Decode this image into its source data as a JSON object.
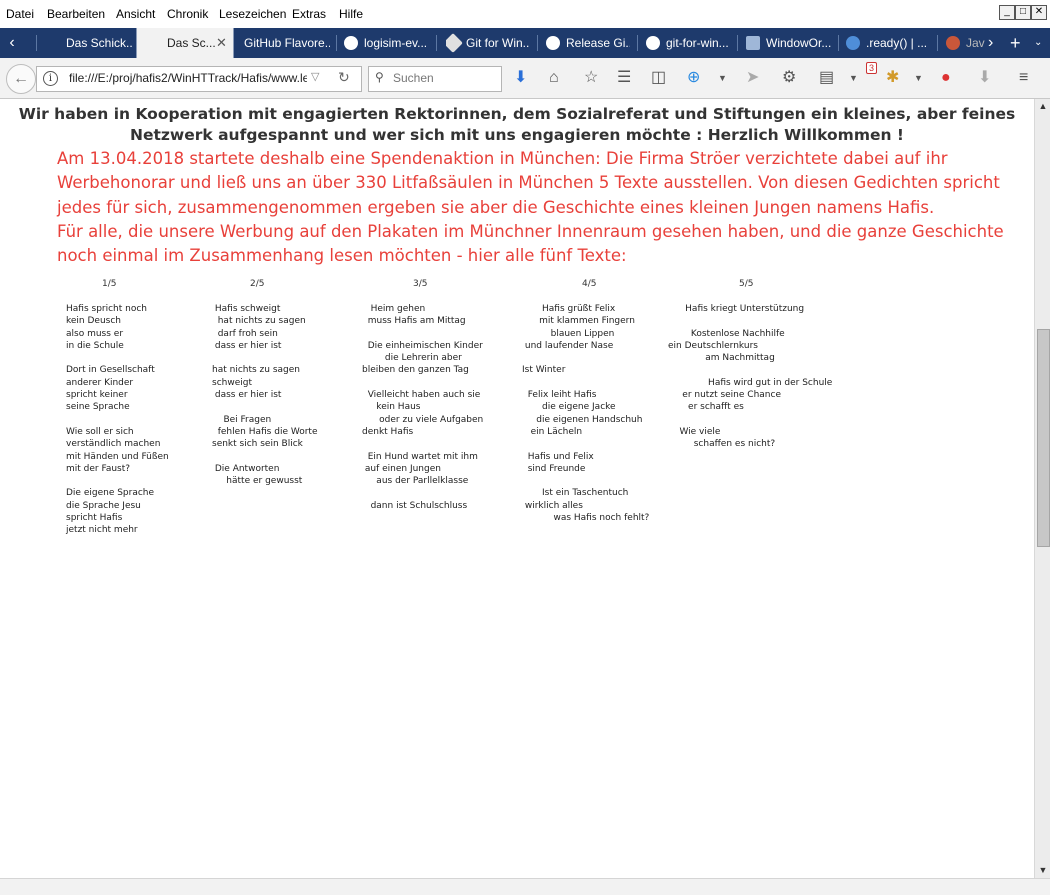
{
  "menu": [
    "Datei",
    "Bearbeiten",
    "Ansicht",
    "Chronik",
    "Lesezeichen",
    "Extras",
    "Hilfe"
  ],
  "tabs": [
    {
      "label": "Das Schick...",
      "active": false
    },
    {
      "label": "Das Sc...",
      "active": true
    },
    {
      "label": "GitHub Flavore...",
      "active": false
    },
    {
      "label": "logisim-ev...",
      "active": false
    },
    {
      "label": "Git for Win...",
      "active": false
    },
    {
      "label": "Release Gi...",
      "active": false
    },
    {
      "label": "git-for-win...",
      "active": false
    },
    {
      "label": "WindowOr...",
      "active": false
    },
    {
      "label": ".ready() | ...",
      "active": false
    },
    {
      "label": "Jav",
      "active": false
    }
  ],
  "nav": {
    "url": "file:///E:/proj/hafis2/WinHTTrack/Hafis/www.lern",
    "search_placeholder": "Suchen",
    "badge_count": "3"
  },
  "content": {
    "intro_line1": "Wir haben in Kooperation mit engagierten Rektorinnen, dem Sozialreferat und Stiftungen ein kleines, aber feines",
    "intro_line2": "Netzwerk aufgespannt und wer sich mit uns engagieren möchte : Herzlich Willkommen !",
    "red_lines": [
      "Am 13.04.2018 startete deshalb eine Spendenaktion in München: Die Firma Ströer verzichtete dabei auf ihr",
      "Werbehonorar und ließ uns an über 330 Litfaßsäulen in München 5 Texte ausstellen. Von diesen Gedichten spricht",
      "jedes für sich, zusammengenommen ergeben sie aber die Geschichte eines kleinen Jungen namens Hafis.",
      "Für alle, die unsere Werbung auf den Plakaten im Münchner Innenraum gesehen haben, und die ganze Geschichte",
      "noch einmal im Zusammenhang lesen möchten - hier alle fünf Texte:"
    ],
    "poems": [
      {
        "number": "1/5",
        "text": "Hafis spricht noch\nkein Deusch\nalso muss er\nin die Schule\n\nDort in Gesellschaft\nanderer Kinder\nspricht keiner\nseine Sprache\n\nWie soll er sich\nverständlich machen\nmit Händen und Füßen\nmit der Faust?\n\nDie eigene Sprache\ndie Sprache Jesu\nspricht Hafis\njetzt nicht mehr"
      },
      {
        "number": "2/5",
        "text": " Hafis schweigt\n  hat nichts zu sagen\n  darf froh sein\n dass er hier ist\n\nhat nichts zu sagen\nschweigt\n dass er hier ist\n\n    Bei Fragen\n  fehlen Hafis die Worte\nsenkt sich sein Blick\n\n Die Antworten\n     hätte er gewusst"
      },
      {
        "number": "3/5",
        "text": "   Heim gehen\n  muss Hafis am Mittag\n\n  Die einheimischen Kinder\n        die Lehrerin aber\nbleiben den ganzen Tag\n\n  Vielleicht haben auch sie\n     kein Haus\n      oder zu viele Aufgaben\ndenkt Hafis\n\n  Ein Hund wartet mit ihm\n auf einen Jungen\n     aus der Parllelklasse\n\n   dann ist Schulschluss"
      },
      {
        "number": "4/5",
        "text": "       Hafis grüßt Felix\n      mit klammen Fingern\n          blauen Lippen\n und laufender Nase\n\nIst Winter\n\n  Felix leiht Hafis\n       die eigene Jacke\n     die eigenen Handschuh\n   ein Lächeln\n\n  Hafis und Felix\n  sind Freunde\n\n       Ist ein Taschentuch\n wirklich alles\n           was Hafis noch fehlt?"
      },
      {
        "number": "5/5",
        "text": "      Hafis kriegt Unterstützung\n\n        Kostenlose Nachhilfe\nein Deutschlernkurs\n             am Nachmittag\n\n              Hafis wird gut in der Schule\n     er nutzt seine Chance\n       er schafft es\n\n    Wie viele\n         schaffen es nicht?"
      }
    ]
  }
}
